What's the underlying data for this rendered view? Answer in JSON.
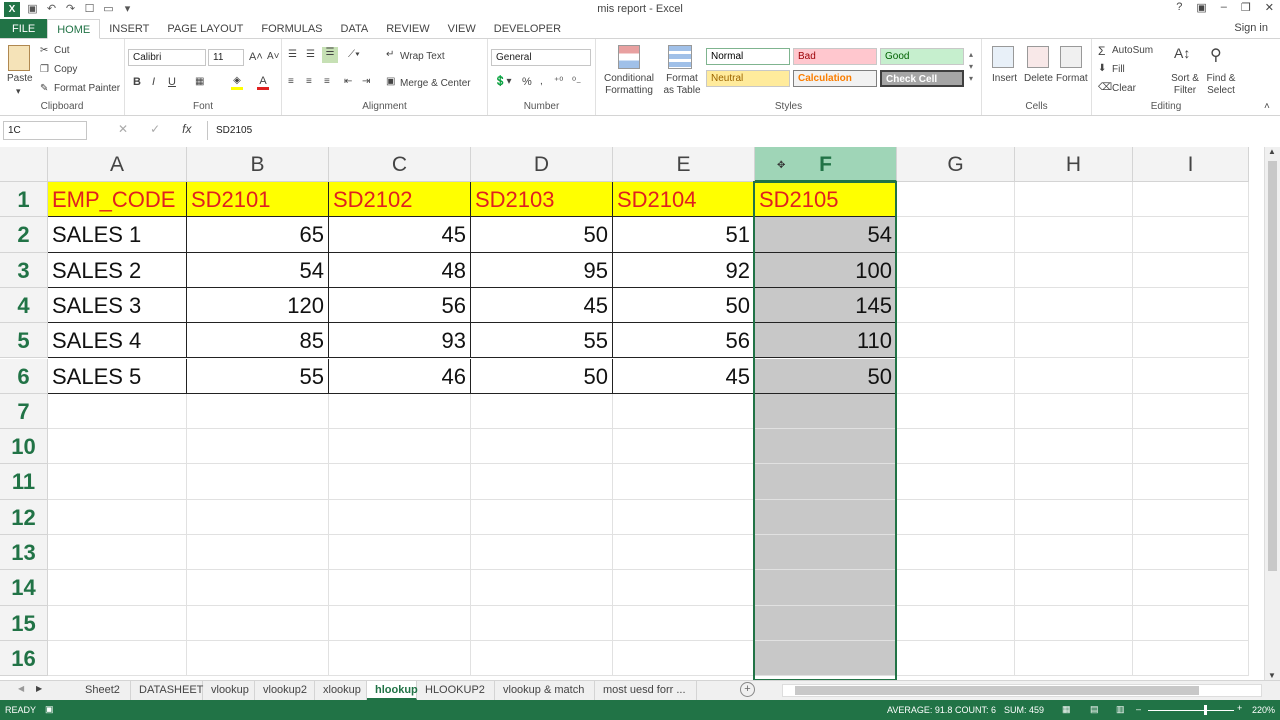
{
  "window": {
    "title": "mis report - Excel",
    "sign_in": "Sign in"
  },
  "ribbon_tabs": [
    "FILE",
    "HOME",
    "INSERT",
    "PAGE LAYOUT",
    "FORMULAS",
    "DATA",
    "REVIEW",
    "VIEW",
    "DEVELOPER"
  ],
  "clipboard": {
    "paste": "Paste",
    "cut": "Cut",
    "copy": "Copy",
    "format_painter": "Format Painter",
    "label": "Clipboard"
  },
  "font": {
    "name": "Calibri",
    "size": "11",
    "bold": "B",
    "italic": "I",
    "underline": "U",
    "label": "Font"
  },
  "alignment": {
    "wrap": "Wrap Text",
    "merge": "Merge & Center",
    "label": "Alignment"
  },
  "number": {
    "format": "General",
    "percent": "%",
    "label": "Number"
  },
  "styles": {
    "conditional": "Conditional Formatting",
    "format_table": "Format as Table",
    "cells": [
      "Normal",
      "Bad",
      "Good",
      "Neutral",
      "Calculation",
      "Check Cell"
    ],
    "label": "Styles"
  },
  "cells_grp": {
    "insert": "Insert",
    "delete": "Delete",
    "format": "Format",
    "label": "Cells"
  },
  "editing": {
    "autosum": "AutoSum",
    "fill": "Fill",
    "clear": "Clear",
    "sort": "Sort & Filter",
    "find": "Find & Select",
    "label": "Editing"
  },
  "formula_bar": {
    "name_box": "1C",
    "cancel": "✕",
    "enter": "✓",
    "fx": "fx",
    "content": "SD2105"
  },
  "columns": [
    "A",
    "B",
    "C",
    "D",
    "E",
    "F",
    "G",
    "H",
    "I"
  ],
  "rows": [
    "1",
    "2",
    "3",
    "4",
    "5",
    "6",
    "7",
    "10",
    "11",
    "12",
    "13",
    "14",
    "15",
    "16"
  ],
  "table": {
    "headers": [
      "EMP_CODE",
      "SD2101",
      "SD2102",
      "SD2103",
      "SD2104",
      "SD2105"
    ],
    "rows": [
      [
        "SALES 1",
        "65",
        "45",
        "50",
        "51",
        "54"
      ],
      [
        "SALES 2",
        "54",
        "48",
        "95",
        "92",
        "100"
      ],
      [
        "SALES 3",
        "120",
        "56",
        "45",
        "50",
        "145"
      ],
      [
        "SALES 4",
        "85",
        "93",
        "55",
        "56",
        "110"
      ],
      [
        "SALES 5",
        "55",
        "46",
        "50",
        "45",
        "50"
      ]
    ]
  },
  "sheets": [
    "Sheet2",
    "DATASHEET",
    "vlookup",
    "vlookup2",
    "xlookup",
    "hlookup",
    "HLOOKUP2",
    "vlookup & match",
    "most uesd forr ..."
  ],
  "active_sheet": "hlookup",
  "status": {
    "ready": "READY",
    "average": "AVERAGE: 91.8",
    "count": "COUNT: 6",
    "sum": "SUM: 459",
    "zoom": "220%"
  }
}
